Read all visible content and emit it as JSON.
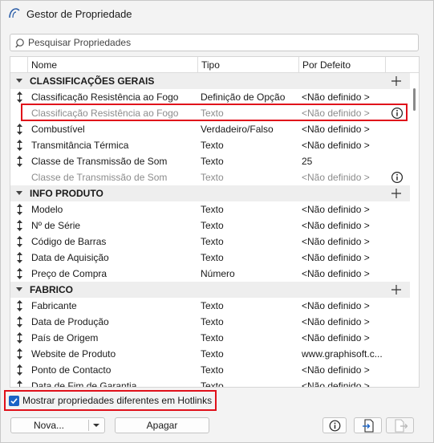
{
  "window": {
    "title": "Gestor de Propriedade"
  },
  "search": {
    "placeholder": "Pesquisar Propriedades"
  },
  "columns": {
    "name": "Nome",
    "type": "Tipo",
    "default": "Por Defeito"
  },
  "groups": [
    {
      "label": "CLASSIFICAÇÕES GERAIS",
      "rows": [
        {
          "name": "Classificação Resistência ao Fogo",
          "type": "Definição de Opção",
          "default": "<Não definido >"
        },
        {
          "name": "Classificação Resistência ao Fogo",
          "type": "Texto",
          "default": "<Não definido >"
        },
        {
          "name": "Combustível",
          "type": "Verdadeiro/Falso",
          "default": "<Não definido >"
        },
        {
          "name": "Transmitância Térmica",
          "type": "Texto",
          "default": "<Não definido >"
        },
        {
          "name": "Classe de Transmissão de Som",
          "type": "Texto",
          "default": "25"
        },
        {
          "name": "Classe de Transmissão de Som",
          "type": "Texto",
          "default": "<Não definido >"
        }
      ]
    },
    {
      "label": "INFO PRODUTO",
      "rows": [
        {
          "name": "Modelo",
          "type": "Texto",
          "default": "<Não definido >"
        },
        {
          "name": "Nº de Série",
          "type": "Texto",
          "default": "<Não definido >"
        },
        {
          "name": "Código de Barras",
          "type": "Texto",
          "default": "<Não definido >"
        },
        {
          "name": "Data de Aquisição",
          "type": "Texto",
          "default": "<Não definido >"
        },
        {
          "name": "Preço de Compra",
          "type": "Número",
          "default": "<Não definido >"
        }
      ]
    },
    {
      "label": "FABRICO",
      "rows": [
        {
          "name": "Fabricante",
          "type": "Texto",
          "default": "<Não definido >"
        },
        {
          "name": "Data de Produção",
          "type": "Texto",
          "default": "<Não definido >"
        },
        {
          "name": "País de Origem",
          "type": "Texto",
          "default": "<Não definido >"
        },
        {
          "name": "Website de Produto",
          "type": "Texto",
          "default": "www.graphisoft.c..."
        },
        {
          "name": "Ponto de Contacto",
          "type": "Texto",
          "default": "<Não definido >"
        },
        {
          "name": "Data de Fim de Garantia",
          "type": "Texto",
          "default": "<Não definido >"
        }
      ]
    }
  ],
  "hotlinks_checkbox": {
    "label": "Mostrar propriedades diferentes em Hotlinks",
    "checked": true
  },
  "buttons": {
    "new": "Nova...",
    "delete": "Apagar"
  },
  "colors": {
    "accent": "#1a63c6",
    "highlight": "#e0101a"
  }
}
